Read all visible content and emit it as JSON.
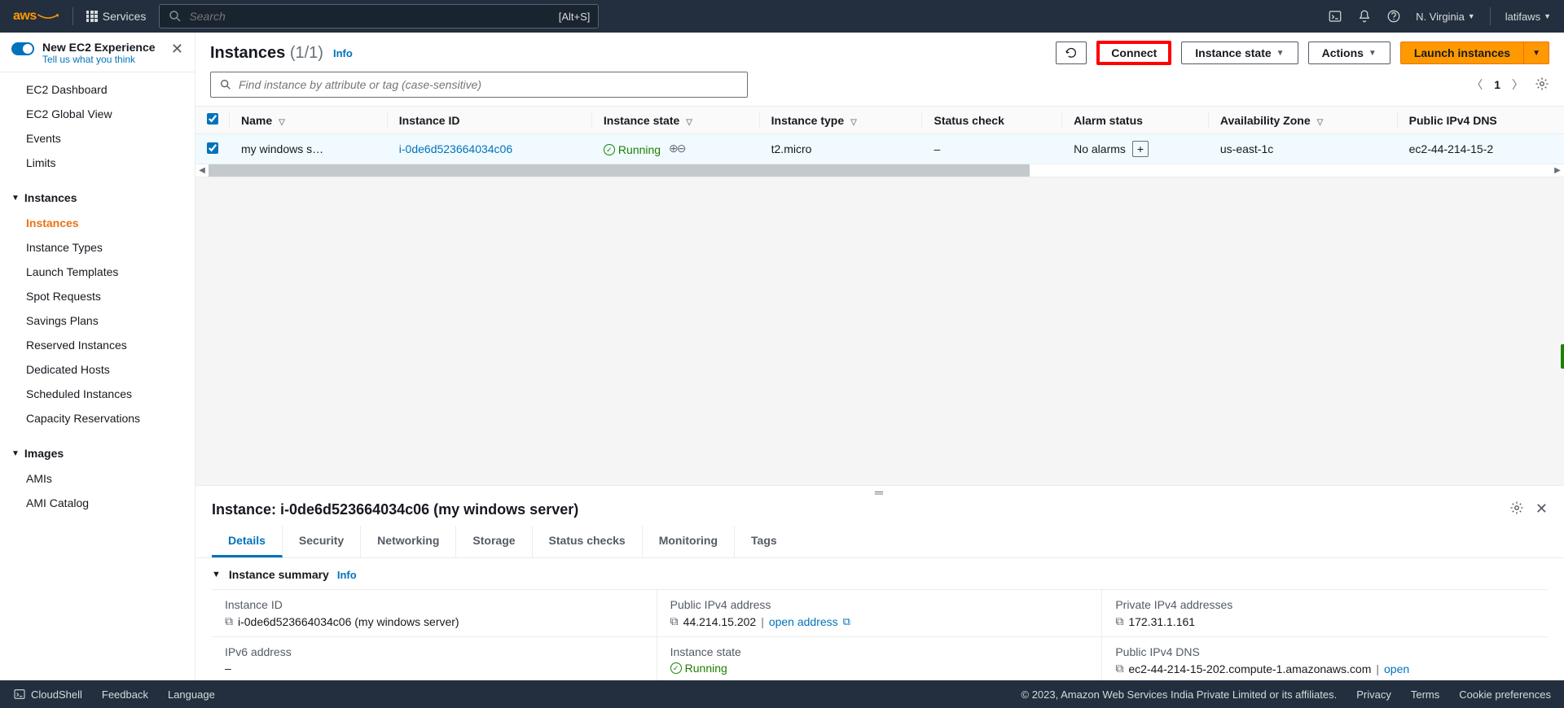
{
  "topnav": {
    "logo": "aws",
    "services": "Services",
    "search_placeholder": "Search",
    "search_shortcut": "[Alt+S]",
    "region": "N. Virginia",
    "user": "latifaws"
  },
  "sidebar": {
    "experience_title": "New EC2 Experience",
    "experience_sub": "Tell us what you think",
    "top_items": [
      "EC2 Dashboard",
      "EC2 Global View",
      "Events",
      "Limits"
    ],
    "groups": [
      {
        "label": "Instances",
        "items": [
          "Instances",
          "Instance Types",
          "Launch Templates",
          "Spot Requests",
          "Savings Plans",
          "Reserved Instances",
          "Dedicated Hosts",
          "Scheduled Instances",
          "Capacity Reservations"
        ],
        "active": "Instances"
      },
      {
        "label": "Images",
        "items": [
          "AMIs",
          "AMI Catalog"
        ]
      }
    ]
  },
  "page": {
    "title": "Instances",
    "count": "(1/1)",
    "info": "Info",
    "refresh_tooltip": "Refresh",
    "connect": "Connect",
    "instance_state": "Instance state",
    "actions": "Actions",
    "launch": "Launch instances",
    "filter_placeholder": "Find instance by attribute or tag (case-sensitive)",
    "page_number": "1"
  },
  "table": {
    "columns": [
      "Name",
      "Instance ID",
      "Instance state",
      "Instance type",
      "Status check",
      "Alarm status",
      "Availability Zone",
      "Public IPv4 DNS"
    ],
    "rows": [
      {
        "name": "my windows s…",
        "instance_id": "i-0de6d523664034c06",
        "state": "Running",
        "type": "t2.micro",
        "status_check": "–",
        "alarm_status": "No alarms",
        "az": "us-east-1c",
        "dns": "ec2-44-214-15-2"
      }
    ]
  },
  "details": {
    "title": "Instance: i-0de6d523664034c06 (my windows server)",
    "tabs": [
      "Details",
      "Security",
      "Networking",
      "Storage",
      "Status checks",
      "Monitoring",
      "Tags"
    ],
    "active_tab": "Details",
    "summary_title": "Instance summary",
    "summary_info": "Info",
    "fields": {
      "instance_id_label": "Instance ID",
      "instance_id_value": "i-0de6d523664034c06 (my windows server)",
      "public_ipv4_label": "Public IPv4 address",
      "public_ipv4_value": "44.214.15.202",
      "open_address": "open address",
      "private_ipv4_label": "Private IPv4 addresses",
      "private_ipv4_value": "172.31.1.161",
      "ipv6_label": "IPv6 address",
      "ipv6_value": "–",
      "instance_state_label": "Instance state",
      "instance_state_value": "Running",
      "public_dns_label": "Public IPv4 DNS",
      "public_dns_value": "ec2-44-214-15-202.compute-1.amazonaws.com",
      "open_link": "open"
    }
  },
  "footer": {
    "cloudshell": "CloudShell",
    "feedback": "Feedback",
    "language": "Language",
    "copyright": "© 2023, Amazon Web Services India Private Limited or its affiliates.",
    "privacy": "Privacy",
    "terms": "Terms",
    "cookies": "Cookie preferences"
  }
}
